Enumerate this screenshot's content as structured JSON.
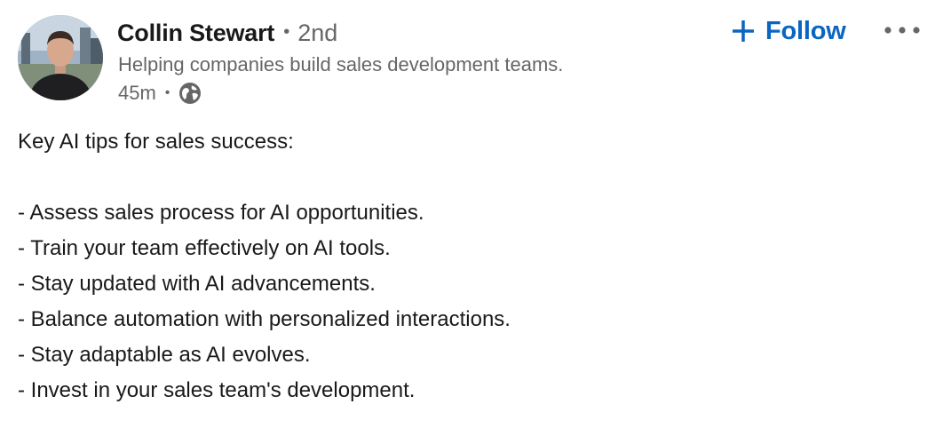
{
  "author": {
    "name": "Collin Stewart",
    "degree": "2nd",
    "headline": "Helping companies build sales development teams.",
    "avatar_icon": "profile-photo"
  },
  "meta": {
    "timestamp": "45m",
    "visibility_icon": "globe-icon"
  },
  "actions": {
    "follow_label": "Follow",
    "more_icon": "ellipsis-icon"
  },
  "post": {
    "intro": "Key AI tips for sales success:",
    "tips": [
      "- Assess sales process for AI opportunities.",
      "- Train your team effectively on AI tools.",
      "- Stay updated with AI advancements.",
      "- Balance automation with personalized interactions.",
      "- Stay adaptable as AI evolves.",
      "- Invest in your sales team's development."
    ]
  },
  "colors": {
    "accent": "#0a66c2",
    "secondary_text": "#666666",
    "primary_text": "#191919"
  }
}
